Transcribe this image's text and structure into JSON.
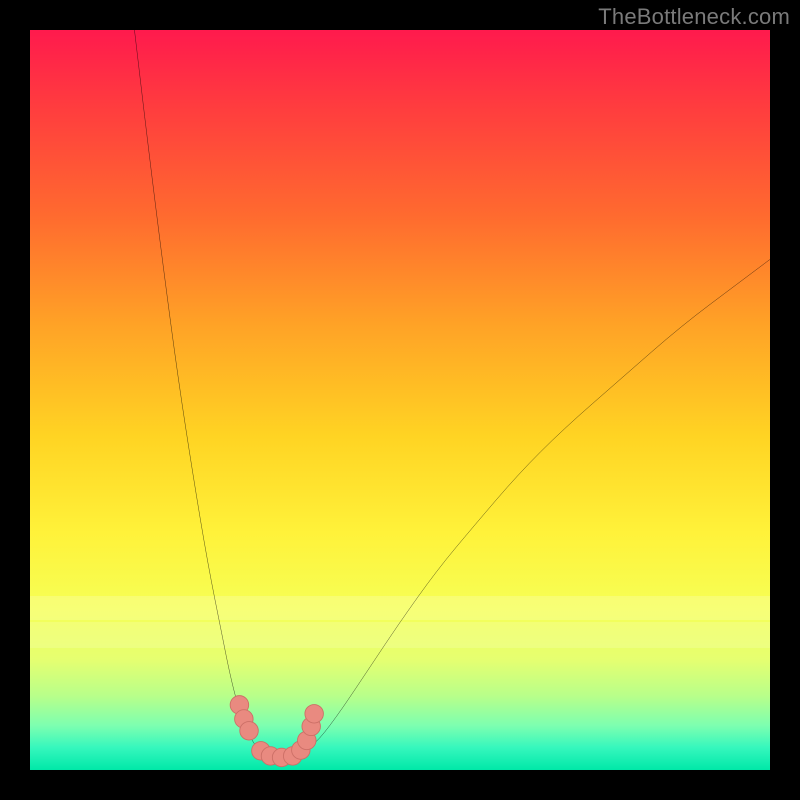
{
  "watermark": {
    "text": "TheBottleneck.com"
  },
  "colors": {
    "background": "#000000",
    "curve_stroke": "#000000",
    "marker_fill": "#e98a80",
    "marker_stroke": "#cc6f66"
  },
  "chart_data": {
    "type": "line",
    "title": "",
    "xlabel": "",
    "ylabel": "",
    "xlim": [
      0,
      100
    ],
    "ylim": [
      0,
      100
    ],
    "grid": false,
    "legend": false,
    "notes": "Bottleneck-style V-curve. No axis ticks or numeric labels are rendered in the source image; x/y values below are estimated from pixel geometry on a 0–100 normalized scale (x: left→right, y: bottom→top).",
    "series": [
      {
        "name": "left-branch",
        "x": [
          14,
          16,
          18,
          20,
          22,
          24,
          26,
          27,
          28,
          29,
          30,
          31
        ],
        "y": [
          101,
          84,
          68,
          53,
          40,
          28,
          18,
          13,
          9,
          6,
          4,
          2.5
        ]
      },
      {
        "name": "right-branch",
        "x": [
          37,
          39,
          42,
          46,
          50,
          55,
          60,
          66,
          72,
          80,
          88,
          96,
          100
        ],
        "y": [
          2.5,
          4,
          8,
          14,
          20,
          27,
          33,
          40,
          46,
          53,
          60,
          66,
          69
        ]
      },
      {
        "name": "valley-floor",
        "x": [
          31,
          32,
          33,
          34,
          35,
          36,
          37
        ],
        "y": [
          2.5,
          1.6,
          1.2,
          1.1,
          1.2,
          1.6,
          2.5
        ]
      }
    ],
    "markers": {
      "name": "highlight-dots",
      "x": [
        28.3,
        28.9,
        29.6,
        31.2,
        32.5,
        34.0,
        35.5,
        36.6,
        37.4,
        38.0,
        38.4
      ],
      "y": [
        8.8,
        6.9,
        5.3,
        2.6,
        1.9,
        1.7,
        1.9,
        2.7,
        4.0,
        5.9,
        7.6
      ],
      "r": 1.25
    }
  }
}
